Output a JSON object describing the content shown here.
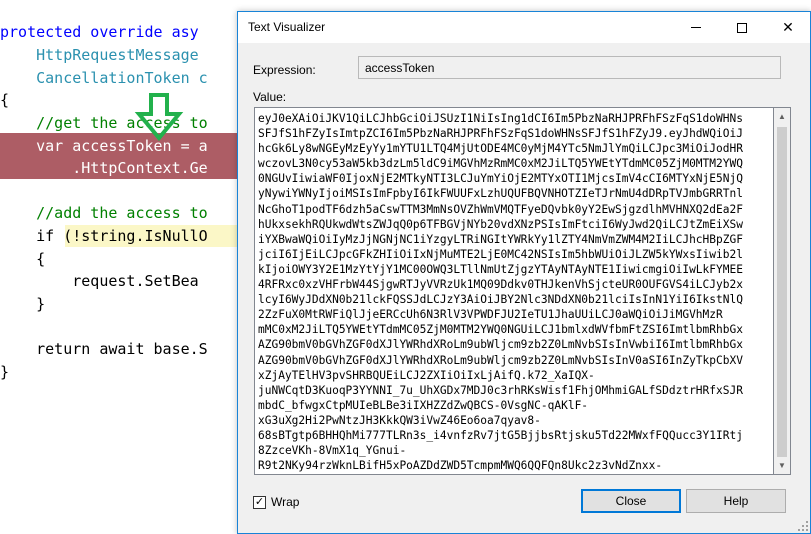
{
  "editor": {
    "lines": [
      {
        "t1": "protected override asy",
        "cls": "kw"
      },
      {
        "t1": "    HttpRequestMessage",
        "cls": "ty"
      },
      {
        "t1": "    CancellationToken c",
        "cls": "ty"
      },
      {
        "t1": "{",
        "cls": ""
      },
      {
        "t1": "    //get the access to",
        "cls": "cm"
      },
      {
        "t1": "    var accessToken = a",
        "cls": "kw"
      },
      {
        "t1": "        .HttpContext.Ge",
        "cls": ""
      },
      {
        "t1": "",
        "cls": ""
      },
      {
        "t1": "    //add the access to",
        "cls": "cm"
      },
      {
        "t1": "    if (!string.IsNullO",
        "cls": ""
      },
      {
        "t1": "    {",
        "cls": ""
      },
      {
        "t1": "        request.SetBea",
        "cls": ""
      },
      {
        "t1": "    }",
        "cls": ""
      },
      {
        "t1": "",
        "cls": ""
      },
      {
        "t1": "    return await base.S",
        "cls": ""
      },
      {
        "t1": "}",
        "cls": ""
      }
    ]
  },
  "dialog": {
    "title": "Text Visualizer",
    "close_glyph": "✕",
    "expression_label": "Expression:",
    "expression_value": "accessToken",
    "value_label": "Value:",
    "value_text": "eyJ0eXAiOiJKV1QiLCJhbGciOiJSUzI1NiIsIng1dCI6Im5PbzNaRHJPRFhFSzFqS1doWHNs\nSFJfS1hFZyIsImtpZCI6Im5PbzNaRHJPRFhFSzFqS1doWHNsSFJfS1hFZyJ9.eyJhdWQiOiJ\nhcGk6Ly8wNGEyMzEyYy1mYTU1LTQ4MjUtODE4MC0yMjM4YTc5NmJlYmQiLCJpc3MiOiJodHR\nwczovL3N0cy53aW5kb3dzLm5ldC9iMGVhMzRmMC0xM2JiLTQ5YWEtYTdmMC05ZjM0MTM2YWQ\n0NGUvIiwiaWF0IjoxNjE2MTkyNTI3LCJuYmYiOjE2MTYxOTI1MjcsImV4cCI6MTYxNjE5NjQ\nyNywiYWNyIjoiMSIsImFpbyI6IkFWUUFxLzhUQUFBQVNHOTZIeTJrNmU4dDRpTVJmbGRRTnl\nNcGhoT1podTF6dzh5aCswTTM3MmNsOVZhWmVMQTFyeDQvbk0yY2EwSjgzdlhMVHNXQ2dEa2F\nhUkxsekhRQUkwdWtsZWJqQ0p6TFBGVjNYb20vdXNzPSIsImFtciI6WyJwd2QiLCJtZmEiXSw\niYXBwaWQiOiIyMzJjNGNjNC1iYzgyLTRiNGItYWRkYy1lZTY4NmVmZWM4M2IiLCJhcHBpZGF\njciI6IjEiLCJpcGFkZHIiOiIxNjMuMTE2LjE0MC42NSIsIm5hbWUiOiJLZW5kYWxsIiwib2l\nkIjoiOWY3Y2E1MzYtYjY1MC00OWQ3LTllNmUtZjgzYTAyNTAyNTE1IiwicmgiOiIwLkFYMEE\n4RFRxc0xzVHFrbW44SjgwRTJyVVRzUk1MQ09Ddkv0THJkenVhSjcteUR0OUFGVS4iLCJyb2x\nlcyI6WyJDdXN0b21lckFQSSJdLCJzY3AiOiJBY2Nlc3NDdXN0b21lciIsInN1YiI6IkstNlQ\n2ZzFuX0MtRWFiQlJjeERCcUh6N3RlV3VPWDFJU2IeTU1JhaUUiLCJ0aWQiOiJiMGVhMzR\nmMC0xM2JiLTQ5YWEtYTdmMC05ZjM0MTM2YWQ0NGUiLCJ1bmlxdWVfbmFtZSI6ImtlbmRhbGx\nAZG90bmV0bGVhZGF0dXJlYWRhdXRoLm9ubWljcm9zb2Z0LmNvbSIsInVwbiI6ImtlbmRhbGx\nAZG90bmV0bGVhZGF0dXJlYWRhdXRoLm9ubWljcm9zb2Z0LmNvbSIsInV0aSI6InZyTkpCbXV\nxZjAyTElHV3pvSHRBQUEiLCJ2ZXIiOiIxLjAifQ.k72_XaIQX-\njuNWCqtD3KuoqP3YYNNI_7u_UhXGDx7MDJ0c3rhRKsWisf1FhjOMhmiGALfSDdztrHRfxSJR\nmbdC_bfwgxCtpMUIeBLBe3iIXHZZdZwQBCS-0VsgNC-qAKlF-\nxG3uXg2Hi2PwNtzJH3KkkQW3iVwZ46Eo6oa7qyav8-\n68sBTgtp6BHHQhMi777TLRn3s_i4vnfzRv7jtG5BjjbsRtjsku5Td22MWxfFQQucc3Y1IRtj\n8ZzceVKh-8VmX1q_YGnui-\nR9t2NKy94rzWknLBifH5xPoAZDdZWD5TcmpmMWQ6QQFQn8Ukc2z3vNdZnxx-",
    "wrap_label": "Wrap",
    "wrap_checked_glyph": "✓",
    "close_button": "Close",
    "help_button": "Help"
  },
  "colors": {
    "keyword": "#0000ff",
    "type": "#2b91af",
    "comment": "#008000",
    "highlight_red": "#ad5d65",
    "highlight_yellow": "#fbf7c7",
    "arrow_green": "#22b14c",
    "dialog_border": "#1883d7"
  }
}
